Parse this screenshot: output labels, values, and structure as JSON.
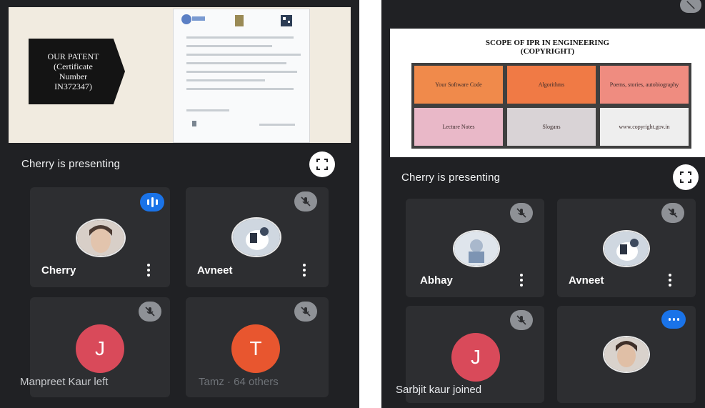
{
  "left": {
    "share": {
      "patent_lines": [
        "OUR PATENT",
        "(Certificate",
        "Number",
        "IN372347)"
      ]
    },
    "presenting_text": "Cherry is presenting",
    "tiles": [
      {
        "name": "Cherry",
        "status": "speaking"
      },
      {
        "name": "Avneet",
        "status": "muted"
      },
      {
        "letter": "J",
        "status": "muted"
      },
      {
        "letter": "T",
        "status": "muted"
      }
    ],
    "toast_left": "Manpreet Kaur left",
    "toast_right": "Tamz · 64 others"
  },
  "right": {
    "share": {
      "title_line1": "SCOPE OF IPR IN ENGINEERING",
      "title_line2": "(COPYRIGHT)",
      "cells": [
        {
          "label": "Your Software Code",
          "color": "#f08a4b"
        },
        {
          "label": "Algorithms",
          "color": "#f07a45"
        },
        {
          "label": "Poems, stories, autobiography",
          "color": "#ef8c80"
        },
        {
          "label": "Lecture Notes",
          "color": "#e9b8c8"
        },
        {
          "label": "Slogans",
          "color": "#d9d3d6"
        },
        {
          "label": "www.copyright.gov.in",
          "color": "#eeeeee"
        }
      ]
    },
    "presenting_text": "Cherry is presenting",
    "tiles": [
      {
        "name": "Abhay",
        "status": "muted"
      },
      {
        "name": "Avneet",
        "status": "muted"
      },
      {
        "letter": "J",
        "status": "muted"
      },
      {
        "status": "speaking"
      }
    ],
    "toast": "Sarbjit kaur joined"
  },
  "colors": {
    "background": "#202124",
    "tile": "#2d2e31",
    "speaking_blue": "#1a73e8",
    "avatar_j": "#d94a5a",
    "avatar_t": "#e8562f"
  },
  "icons": [
    "fullscreen-icon",
    "mic-off-icon",
    "speaking-indicator-icon",
    "more-vert-icon"
  ]
}
